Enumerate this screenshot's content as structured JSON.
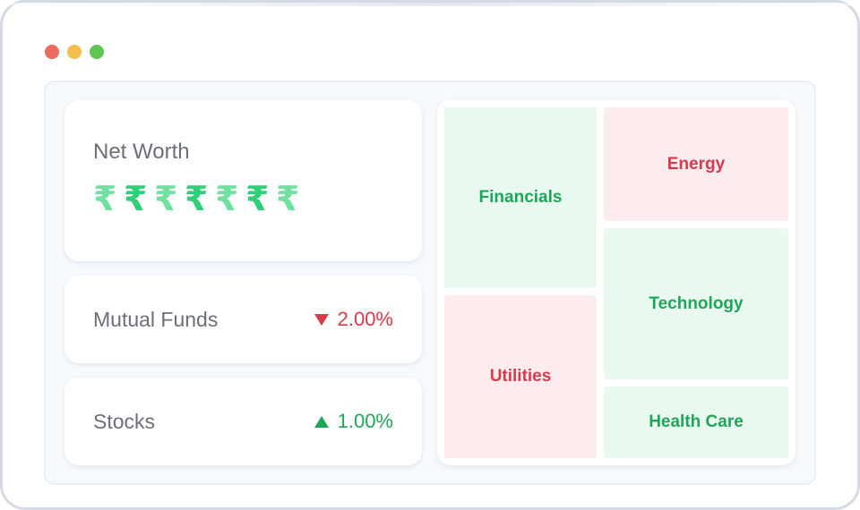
{
  "window": {
    "controls": [
      {
        "name": "close",
        "color": "#ec6a5e"
      },
      {
        "name": "minimize",
        "color": "#f4bf4f"
      },
      {
        "name": "maximize",
        "color": "#61c554"
      }
    ]
  },
  "net_worth": {
    "title": "Net Worth",
    "masked_value": [
      "₹",
      "₹",
      "₹",
      "₹",
      "₹",
      "₹",
      "₹"
    ],
    "symbol_colors": [
      "#6fe0a0",
      "#2fcf78"
    ]
  },
  "holdings": [
    {
      "label": "Mutual Funds",
      "direction": "down",
      "change": "2.00%",
      "color": "#d63a4c"
    },
    {
      "label": "Stocks",
      "direction": "up",
      "change": "1.00%",
      "color": "#1fa55a"
    }
  ],
  "sector_map": {
    "colors": {
      "gain_text": "#1fa55a",
      "loss_text": "#d63a4c"
    },
    "tiles": [
      {
        "label": "Financials",
        "trend": "gain"
      },
      {
        "label": "Energy",
        "trend": "loss"
      },
      {
        "label": "Technology",
        "trend": "gain"
      },
      {
        "label": "Utilities",
        "trend": "loss"
      },
      {
        "label": "Health Care",
        "trend": "gain"
      }
    ]
  }
}
